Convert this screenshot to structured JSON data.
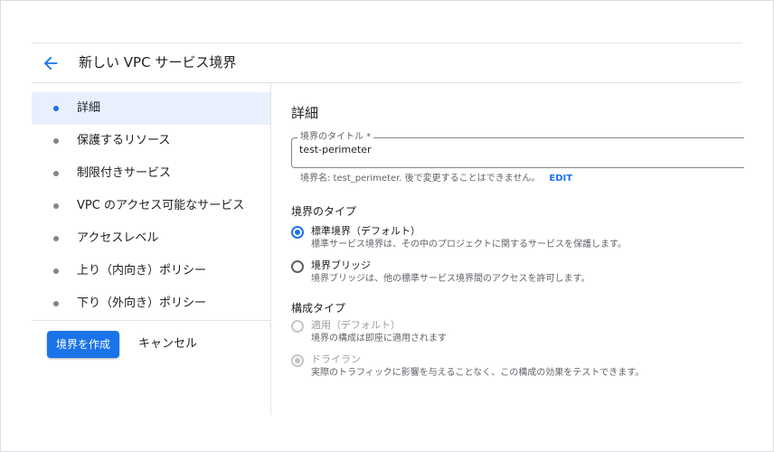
{
  "header": {
    "title": "新しい VPC サービス境界"
  },
  "sidebar": {
    "items": [
      {
        "label": "詳細"
      },
      {
        "label": "保護するリソース"
      },
      {
        "label": "制限付きサービス"
      },
      {
        "label": "VPC のアクセス可能なサービス"
      },
      {
        "label": "アクセスレベル"
      },
      {
        "label": "上り（内向き）ポリシー"
      },
      {
        "label": "下り（外向き）ポリシー"
      }
    ],
    "active_index": 0,
    "create_label": "境界を作成",
    "cancel_label": "キャンセル"
  },
  "main": {
    "section_title": "詳細",
    "title_field": {
      "label": "境界のタイトル *",
      "value": "test-perimeter"
    },
    "helper_text": "境界名: test_perimeter. 後で変更することはできません。",
    "edit_label": "EDIT",
    "perimeter_type": {
      "title": "境界のタイプ",
      "options": [
        {
          "label": "標準境界（デフォルト）",
          "desc": "標準サービス境界は、その中のプロジェクトに関するサービスを保護します。",
          "checked": true
        },
        {
          "label": "境界ブリッジ",
          "desc": "境界ブリッジは、他の標準サービス境界間のアクセスを許可します。",
          "checked": false
        }
      ]
    },
    "config_type": {
      "title": "構成タイプ",
      "options": [
        {
          "label": "適用（デフォルト）",
          "desc": "境界の構成は即座に適用されます",
          "checked": false
        },
        {
          "label": "ドライラン",
          "desc": "実際のトラフィックに影響を与えることなく、この構成の効果をテストできます。",
          "checked": true
        }
      ]
    }
  },
  "colors": {
    "accent": "#1a73e8",
    "active_nav_bg": "#e8f0fe",
    "disabled": "#9aa0a6"
  }
}
